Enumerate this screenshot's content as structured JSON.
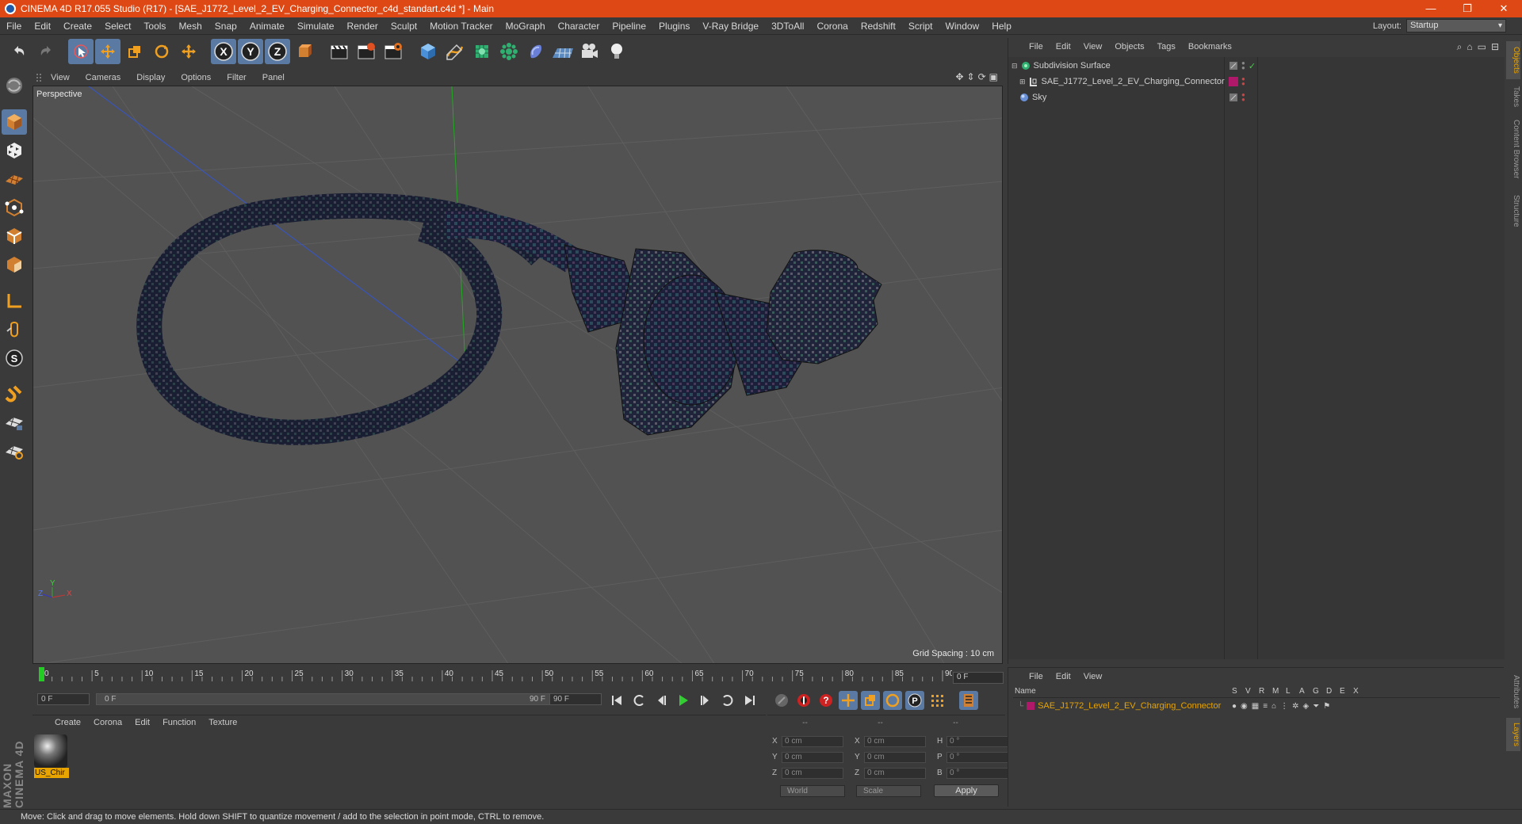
{
  "window": {
    "title": "CINEMA 4D R17.055 Studio (R17) - [SAE_J1772_Level_2_EV_Charging_Connector_c4d_standart.c4d *] - Main",
    "controls": [
      "—",
      "❐",
      "✕"
    ]
  },
  "menubar": {
    "items": [
      "File",
      "Edit",
      "Create",
      "Select",
      "Tools",
      "Mesh",
      "Snap",
      "Animate",
      "Simulate",
      "Render",
      "Sculpt",
      "Motion Tracker",
      "MoGraph",
      "Character",
      "Pipeline",
      "Plugins",
      "V-Ray Bridge",
      "3DToAll",
      "Corona",
      "Redshift",
      "Script",
      "Window",
      "Help"
    ],
    "layout_label": "Layout:",
    "layout_value": "Startup"
  },
  "toolbar": {
    "icons": [
      "undo-icon",
      "redo-icon",
      "live-selection-icon",
      "move-icon",
      "scale-icon",
      "rotate-icon",
      "recent-tool-icon",
      "x-axis-icon",
      "y-axis-icon",
      "z-axis-icon",
      "coordinate-system-icon",
      "render-view-icon",
      "render-picture-viewer-icon",
      "edit-render-settings-icon",
      "cube-icon",
      "pen-spline-icon",
      "subdivision-nurbs-icon",
      "array-icon",
      "deformer-icon",
      "floor-icon",
      "camera-icon",
      "light-icon"
    ],
    "axis_labels": [
      "X",
      "Y",
      "Z"
    ]
  },
  "viewport": {
    "menu": [
      "View",
      "Cameras",
      "Display",
      "Options",
      "Filter",
      "Panel"
    ],
    "view_name": "Perspective",
    "grid_spacing": "Grid Spacing : 10 cm",
    "axis_labels": [
      "Z",
      "Y",
      "X"
    ]
  },
  "timeline": {
    "ticks": [
      "0",
      "5",
      "10",
      "15",
      "20",
      "25",
      "30",
      "35",
      "40",
      "45",
      "50",
      "55",
      "60",
      "65",
      "70",
      "75",
      "80",
      "85",
      "90"
    ],
    "current_frame": "0 F"
  },
  "playback": {
    "start_field": "0 F",
    "range_start": "0 F",
    "range_end": "90 F",
    "end_field": "90 F"
  },
  "material_manager": {
    "menu": [
      "Create",
      "Corona",
      "Edit",
      "Function",
      "Texture"
    ],
    "materials": [
      {
        "name": "US_Chir"
      }
    ]
  },
  "coordinates": {
    "headers": [
      "--",
      "--",
      "--"
    ],
    "rows": [
      {
        "pos_label": "X",
        "pos": "0 cm",
        "size_label": "X",
        "size": "0 cm",
        "rot_label": "H",
        "rot": "0 °"
      },
      {
        "pos_label": "Y",
        "pos": "0 cm",
        "size_label": "Y",
        "size": "0 cm",
        "rot_label": "P",
        "rot": "0 °"
      },
      {
        "pos_label": "Z",
        "pos": "0 cm",
        "size_label": "Z",
        "size": "0 cm",
        "rot_label": "B",
        "rot": "0 °"
      }
    ],
    "mode": "World",
    "transform": "Scale",
    "apply": "Apply"
  },
  "object_manager": {
    "menu": [
      "File",
      "Edit",
      "View",
      "Objects",
      "Tags",
      "Bookmarks"
    ],
    "objects": [
      {
        "name": "Subdivision Surface",
        "icon": "subdivision-surface-icon"
      },
      {
        "name": "SAE_J1772_Level_2_EV_Charging_Connector",
        "icon": "null-object-icon"
      },
      {
        "name": "Sky",
        "icon": "sky-icon"
      }
    ]
  },
  "right_tabs": [
    "Objects",
    "Takes",
    "Content Browser",
    "Structure",
    "Attributes",
    "Layers"
  ],
  "layer_manager": {
    "menu": [
      "File",
      "Edit",
      "View"
    ],
    "columns": [
      "Name",
      "S",
      "V",
      "R",
      "M",
      "L",
      "A",
      "G",
      "D",
      "E",
      "X"
    ],
    "layers": [
      {
        "name": "SAE_J1772_Level_2_EV_Charging_Connector",
        "color": "#b0186a"
      }
    ]
  },
  "status": {
    "text": "Move: Click and drag to move elements. Hold down SHIFT to quantize movement / add to the selection in point mode, CTRL to remove."
  },
  "colors": {
    "title_bar": "#dd4814",
    "accent": "#5a7aa3",
    "highlight": "#e8a400"
  }
}
